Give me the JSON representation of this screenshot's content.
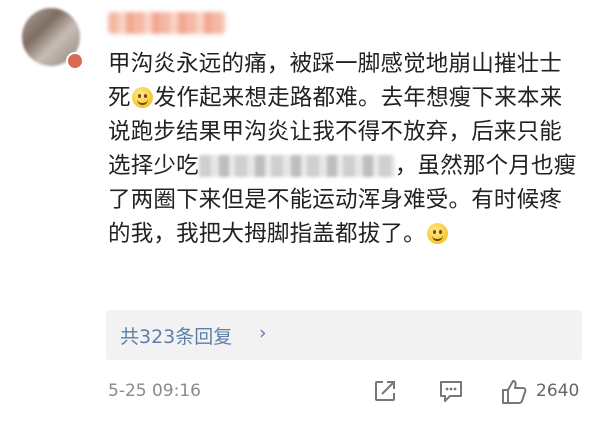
{
  "comment": {
    "paragraph_part1": "甲沟炎永远的痛，被踩一脚感觉地崩山摧壮士死",
    "paragraph_part2": "发作起来想走路都难。去年想瘦下来本来说跑步结果甲沟炎让我不得不放弃，后来只能选择少吃",
    "paragraph_part3": "，虽然那个月也瘦了两圈下来但是不能运动浑身难受。有时候疼的我，我把大拇脚指盖都拔了。",
    "emoji_name": "smile-emoji"
  },
  "replies": {
    "label": "共323条回复",
    "chevron": "›"
  },
  "footer": {
    "timestamp": "5-25 09:16",
    "like_count": "2640",
    "icons": [
      "share-icon",
      "comment-icon",
      "like-icon"
    ]
  },
  "colors": {
    "link": "#5d7fa8",
    "text": "#222222",
    "meta": "#8a8a8a"
  }
}
